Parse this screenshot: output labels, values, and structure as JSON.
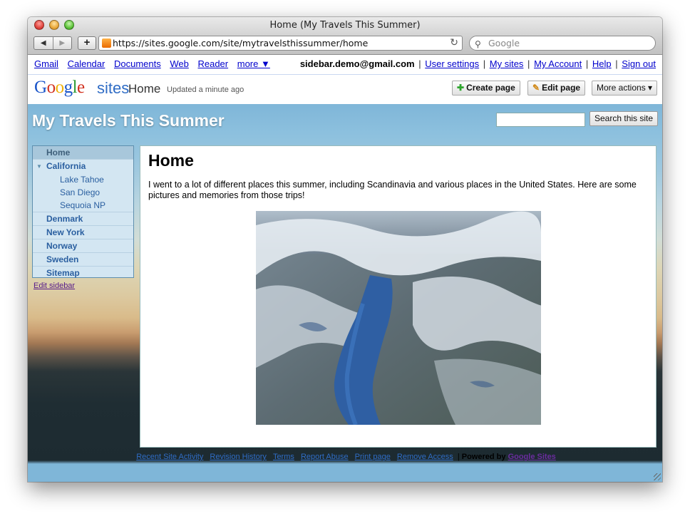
{
  "window": {
    "title": "Home (My Travels This Summer)"
  },
  "toolbar": {
    "back_label": "◀",
    "forward_label": "▶",
    "add_label": "+",
    "url": "https://sites.google.com/site/mytravelsthissummer/home",
    "search_placeholder": "Google"
  },
  "gbar": {
    "links": [
      "Gmail",
      "Calendar",
      "Documents",
      "Web",
      "Reader"
    ],
    "more": "more ▼",
    "email": "sidebar.demo@gmail.com",
    "right_links": [
      "User settings",
      "My sites",
      "My Account",
      "Help",
      "Sign out"
    ]
  },
  "sites_header": {
    "logo": [
      "G",
      "o",
      "o",
      "g",
      "l",
      "e"
    ],
    "product": "sites",
    "page_name": "Home",
    "updated": "Updated a minute ago",
    "create_page": "Create page",
    "edit_page": "Edit page",
    "more_actions": "More actions ▾"
  },
  "site": {
    "title": "My Travels This Summer",
    "search_button": "Search this site"
  },
  "sidebar": {
    "items": [
      {
        "label": "Home"
      },
      {
        "label": "California"
      },
      {
        "label": "Lake Tahoe"
      },
      {
        "label": "San Diego"
      },
      {
        "label": "Sequoia NP"
      },
      {
        "label": "Denmark"
      },
      {
        "label": "New York"
      },
      {
        "label": "Norway"
      },
      {
        "label": "Sweden"
      },
      {
        "label": "Sitemap"
      }
    ],
    "edit_link": "Edit sidebar"
  },
  "content": {
    "heading": "Home",
    "intro": "I went to a lot of different places this summer, including Scandinavia and various places in the United States. Here are some pictures and memories from those trips!"
  },
  "footer": {
    "links": [
      "Recent Site Activity",
      "Revision History",
      "Terms",
      "Report Abuse",
      "Print page",
      "Remove Access"
    ],
    "powered": "Powered by",
    "brand": "Google Sites"
  }
}
